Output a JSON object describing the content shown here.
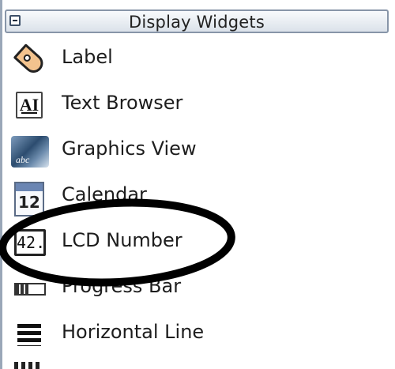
{
  "panel": {
    "group_title": "Display Widgets",
    "items": [
      {
        "label": "Label",
        "icon": "label-tag-icon"
      },
      {
        "label": "Text Browser",
        "icon": "text-browser-icon",
        "icon_text": "AI"
      },
      {
        "label": "Graphics View",
        "icon": "graphics-view-icon",
        "icon_text": "abc"
      },
      {
        "label": "Calendar",
        "icon": "calendar-icon",
        "icon_text": "12"
      },
      {
        "label": "LCD Number",
        "icon": "lcd-number-icon",
        "icon_text": "42."
      },
      {
        "label": "Progress Bar",
        "icon": "progress-bar-icon",
        "progress_fraction": 0.5
      },
      {
        "label": "Horizontal Line",
        "icon": "horizontal-line-icon"
      }
    ]
  },
  "annotation": {
    "type": "hand-drawn ellipse",
    "highlighted_item": "LCD Number",
    "color": "#000000"
  }
}
